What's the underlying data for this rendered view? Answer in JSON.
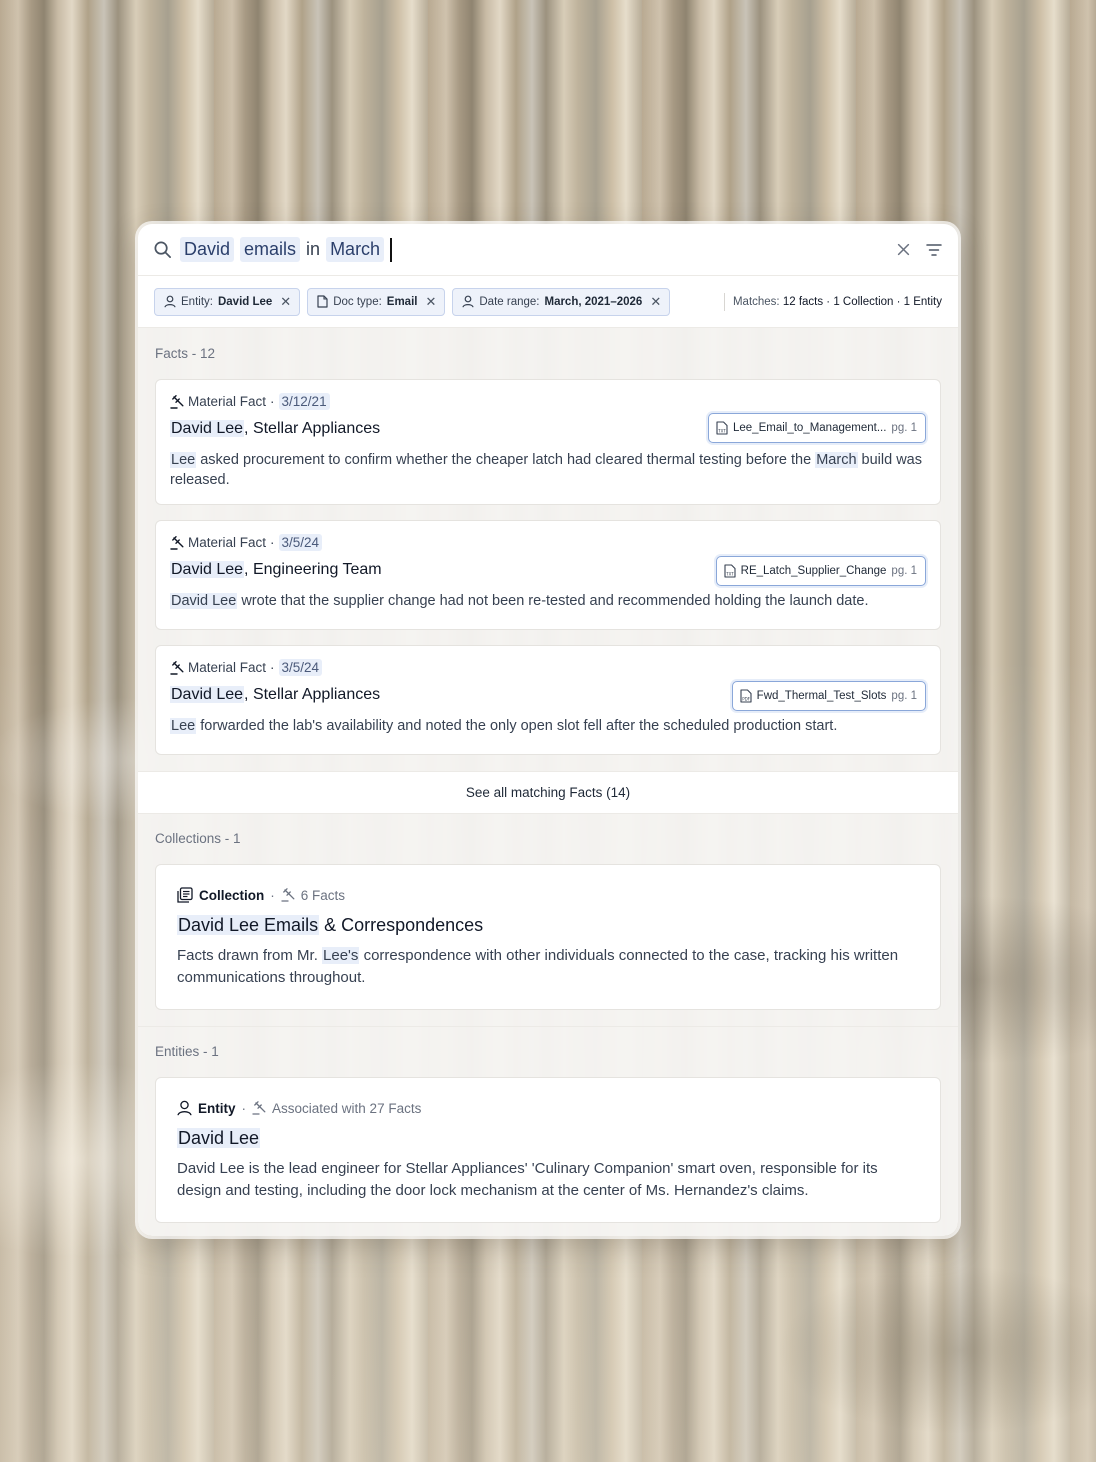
{
  "search": {
    "tokens": [
      {
        "text": "David",
        "highlighted": true
      },
      {
        "text": "emails",
        "highlighted": true
      },
      {
        "text": "in",
        "highlighted": false
      },
      {
        "text": "March",
        "highlighted": true
      }
    ],
    "icons": {
      "search": "search-icon",
      "clear": "close-icon",
      "filter": "filter-lines-icon"
    }
  },
  "filters": [
    {
      "icon": "person-icon",
      "label": "Entity:",
      "value": "David Lee"
    },
    {
      "icon": "document-icon",
      "label": "Doc type:",
      "value": "Email"
    },
    {
      "icon": "person-icon",
      "label": "Date range:",
      "value": "March, 2021–2026"
    }
  ],
  "matches": {
    "label": "Matches:",
    "summary": "12 facts · 1 Collection · 1 Entity"
  },
  "facts": {
    "label": "Facts - 12",
    "items": [
      {
        "type": "Material Fact",
        "sep": "·",
        "date": "3/12/21",
        "title_name": "David Lee",
        "title_rest": ", Stellar Appliances",
        "doc": "Lee_Email_to_Management...",
        "doc_icon": "txt-file-icon",
        "page": "pg. 1",
        "body_hl": "Lee",
        "body_mid": " asked procurement to confirm whether the cheaper latch had cleared thermal testing before the ",
        "body_hl2": "March",
        "body_end": " build was released."
      },
      {
        "type": "Material Fact",
        "sep": "·",
        "date": "3/5/24",
        "title_name": "David Lee",
        "title_rest": ", Engineering Team",
        "doc": "RE_Latch_Supplier_Change",
        "doc_icon": "txt-file-icon",
        "page": "pg. 1",
        "body_hl": "David Lee",
        "body_mid": " wrote that the supplier change had not been re-tested and recommended holding the launch date.",
        "body_hl2": "",
        "body_end": ""
      },
      {
        "type": "Material Fact",
        "sep": "·",
        "date": "3/5/24",
        "title_name": "David Lee",
        "title_rest": ", Stellar Appliances",
        "doc": "Fwd_Thermal_Test_Slots",
        "doc_icon": "pdf-file-icon",
        "page": "pg. 1",
        "body_hl": "Lee",
        "body_mid": " forwarded the lab's availability and noted the only open slot fell after the scheduled production start.",
        "body_hl2": "",
        "body_end": ""
      }
    ],
    "see_all": "See all matching Facts (14)"
  },
  "collections": {
    "label": "Collections - 1",
    "item": {
      "kind": "Collection",
      "sep": "·",
      "count": "6 Facts",
      "title_hl": "David Lee Emails",
      "title_rest": " & Correspondences",
      "body_pre": "Facts drawn from Mr. ",
      "body_hl": "Lee's",
      "body_post": " correspondence with other individuals connected to the case, tracking his written communications throughout."
    }
  },
  "entities": {
    "label": "Entities - 1",
    "item": {
      "kind": "Entity",
      "sep": "·",
      "count": "Associated with 27 Facts",
      "title": "David Lee",
      "body": "David Lee is the lead engineer for Stellar Appliances' 'Culinary Companion' smart oven, responsible for its design and testing, including the door lock mechanism at the center of Ms. Hernandez's claims."
    }
  },
  "colors": {
    "highlight": "#e8eef9",
    "chip_border": "#c7d3ec",
    "doc_border": "#8aa7d9"
  }
}
